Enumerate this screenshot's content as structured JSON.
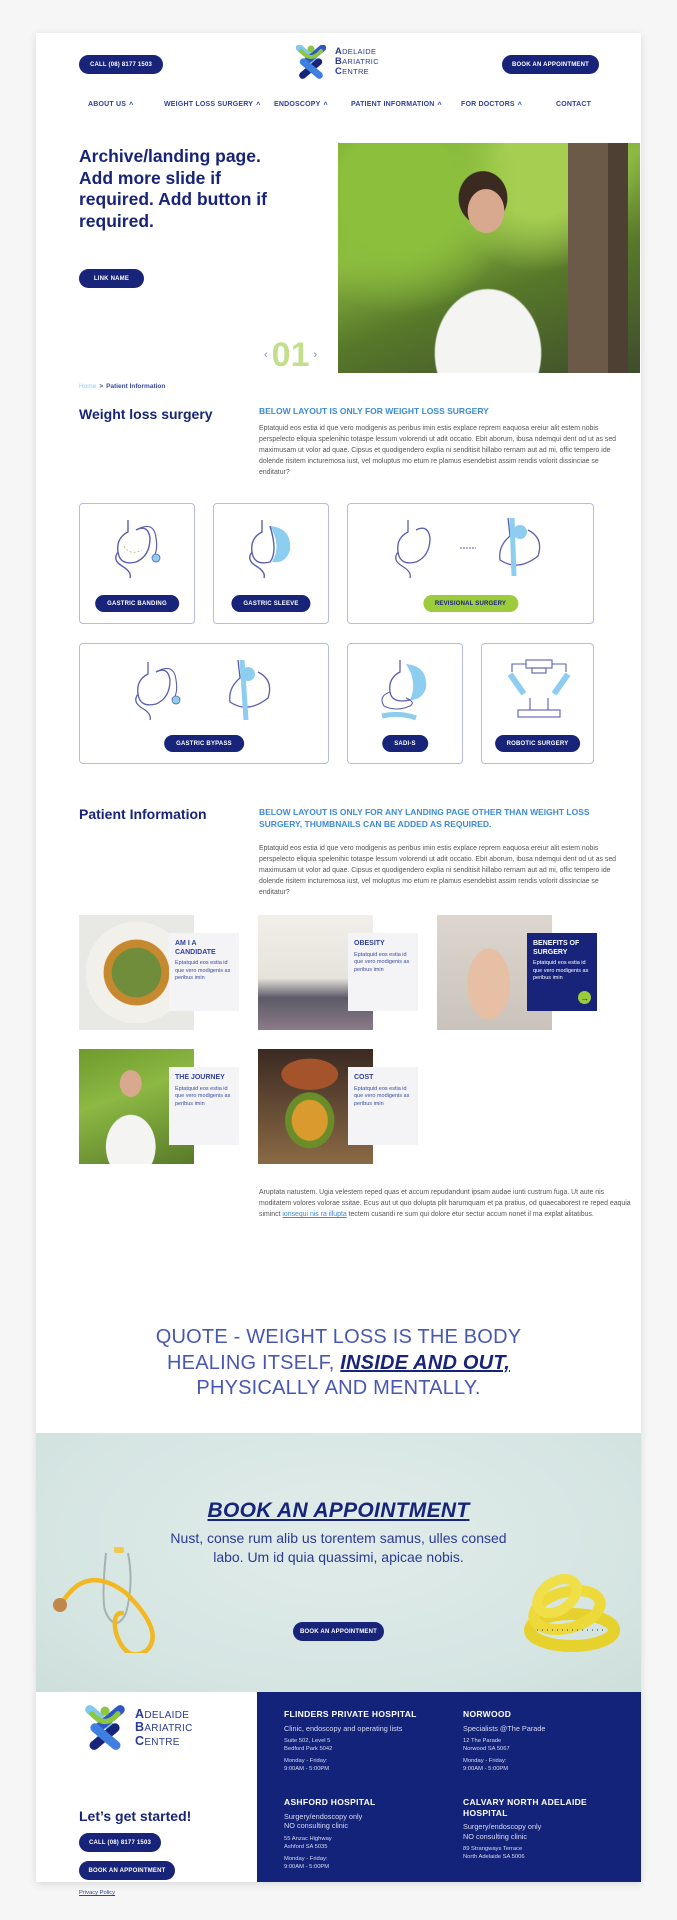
{
  "header": {
    "call_button": "CALL (08) 8177 1503",
    "book_button": "BOOK AN APPOINTMENT",
    "logo": {
      "line1_initial": "A",
      "line1_rest": "DELAIDE",
      "line2_initial": "B",
      "line2_rest": "ARIATRIC",
      "line3_initial": "C",
      "line3_rest": "ENTRE"
    },
    "nav": [
      {
        "label": "ABOUT US",
        "has_dropdown": true
      },
      {
        "label": "WEIGHT LOSS SURGERY",
        "has_dropdown": true
      },
      {
        "label": "ENDOSCOPY",
        "has_dropdown": true
      },
      {
        "label": "PATIENT INFORMATION",
        "has_dropdown": true
      },
      {
        "label": "FOR DOCTORS",
        "has_dropdown": true
      },
      {
        "label": "CONTACT",
        "has_dropdown": false
      }
    ],
    "caret_glyph": "^"
  },
  "hero": {
    "title": "Archive/landing page. Add more slide if required. Add button if required.",
    "link_button": "LINK NAME",
    "slide_number": "01",
    "prev_glyph": "‹",
    "next_glyph": "›",
    "image_alt": "Smiling doctor in white coat standing by a tree"
  },
  "breadcrumb": {
    "home": "Home",
    "separator": ">",
    "current": "Patient Information"
  },
  "weight_loss": {
    "title": "Weight loss surgery",
    "subtitle": "BELOW LAYOUT IS ONLY FOR WEIGHT LOSS SURGERY",
    "body": "Eptatquid eos estia id que vero modigenis as peribus imin estis explace reprem eaquosa ereiur alit estem nobis perspelecto eliquia spelenihic totaspe lessum volorendi ut adit occatio. Ebit aborum, ibusa ndemqui dent od ut as sed maximusam ut volor ad quae. Cipsus et quodigendero explia ni senditisit hillabo rernam aut ad mi, offic tempero ide dolende risitem incturemosa iust, vel moluptus mo etum re plamus esendebist assim rendis volorit dissinciae se enditatur?",
    "tiles": [
      {
        "label": "GASTRIC BANDING",
        "style": "primary"
      },
      {
        "label": "GASTRIC SLEEVE",
        "style": "primary"
      },
      {
        "label": "REVISIONAL SURGERY",
        "style": "accent"
      },
      {
        "label": "GASTRIC BYPASS",
        "style": "primary"
      },
      {
        "label": "SADI-S",
        "style": "primary"
      },
      {
        "label": "ROBOTIC SURGERY",
        "style": "primary"
      }
    ]
  },
  "patient_info": {
    "title": "Patient Information",
    "subtitle": "BELOW LAYOUT IS ONLY FOR ANY LANDING PAGE OTHER THAN WEIGHT LOSS SURGERY, THUMBNAILS CAN BE ADDED AS REQUIRED.",
    "body": "Eptatquid eos estia id que vero modigenis as peribus imin estis explace reprem eaquosa ereiur alit estem nobis perspelecto eliquia spelenihic totaspe lessum volorendi ut adit occatio. Ebit aborum, ibusa ndemqui dent od ut as sed maximusam ut volor ad quae. Cipsus et quodigendero explia ni senditisit hillabo rernam aut ad mi, offic tempero ide dolende risitem incturemosa iust, vel moluptus mo etum re plamus esendebist assim rendis volorit dissinciae se enditatur?",
    "cards": [
      {
        "title": "AM I A CANDIDATE",
        "text": "Eptatquid eos estia id que vero modigenis as peribus imin",
        "active": false
      },
      {
        "title": "OBESITY",
        "text": "Eptatquid eos estia id que vero modigenis as peribus imin",
        "active": false
      },
      {
        "title": "BENEFITS OF SURGERY",
        "text": "Eptatquid eos estia id que vero modigenis as peribus imin",
        "active": true
      },
      {
        "title": "THE JOURNEY",
        "text": "Eptatquid eos estia id que vero modigenis as peribus imin",
        "active": false
      },
      {
        "title": "COST",
        "text": "Eptatquid eos estia id que vero modigenis as peribus imin",
        "active": false
      }
    ],
    "arrow_glyph": "→",
    "after_text_1": "Aruptata natustem. Ugia velestem reped quas et accum repudandunt ipsam audae iunti custrum fuga. Ut aute nis moditatem volores volorae ssitae. Ecus aut ut quo dolupta plit harumquam et pa pratius, od quaecaborest re reped eaquia siminct ",
    "after_link": "ionsequi nis ra illupta",
    "after_text_2": " tectem cusandi re sum qui dolore etur sectur accum nonet il ma explat alitatibus."
  },
  "quote": {
    "part1": "QUOTE - WEIGHT LOSS IS THE BODY HEALING ITSELF, ",
    "emphasis": "INSIDE AND OUT,",
    "part2": " PHYSICALLY AND MENTALLY."
  },
  "booking": {
    "title": "BOOK AN APPOINTMENT",
    "text": "Nust, conse rum alib us torentem samus, ulles consed labo. Um id quia quassimi, apicae nobis.",
    "button": "BOOK AN APPOINTMENT"
  },
  "footer": {
    "tagline": "Let’s get started!",
    "call_button": "CALL (08) 8177 1503",
    "book_button": "BOOK AN APPOINTMENT",
    "privacy": "Privacy Policy",
    "locations": [
      {
        "name": "FLINDERS PRIVATE HOSPITAL",
        "sub": [
          "Clinic, endoscopy and operating lists"
        ],
        "address": [
          "Suite 502, Level 5",
          "Bedford Park 5042"
        ],
        "hours": [
          "Monday - Friday:",
          "9:00AM - 5:00PM"
        ]
      },
      {
        "name": "NORWOOD",
        "sub": [
          "Specialists @The Parade"
        ],
        "address": [
          "12 The Parade",
          "Norwood SA 5067"
        ],
        "hours": [
          "Monday - Friday:",
          "9:00AM - 5:00PM"
        ]
      },
      {
        "name": "ASHFORD HOSPITAL",
        "sub": [
          "Surgery/endoscopy only",
          "NO consulting clinic"
        ],
        "address": [
          "55 Anzac Highway",
          "Ashford SA 5035"
        ],
        "hours": [
          "Monday - Friday:",
          "9:00AM - 5:00PM"
        ]
      },
      {
        "name": "CALVARY NORTH ADELAIDE HOSPITAL",
        "sub": [
          "Surgery/endoscopy only",
          "NO consulting clinic"
        ],
        "address": [
          "89 Strangways Terrace",
          "North Adelaide SA 5006"
        ],
        "hours": []
      }
    ]
  },
  "colors": {
    "primary_navy": "#172479",
    "accent_green": "#9ccb3b",
    "accent_blue": "#3d8bd6",
    "light_blue": "#8ccdf0",
    "footer_navy": "#14237a",
    "booking_bg": "#d5e5e2"
  }
}
